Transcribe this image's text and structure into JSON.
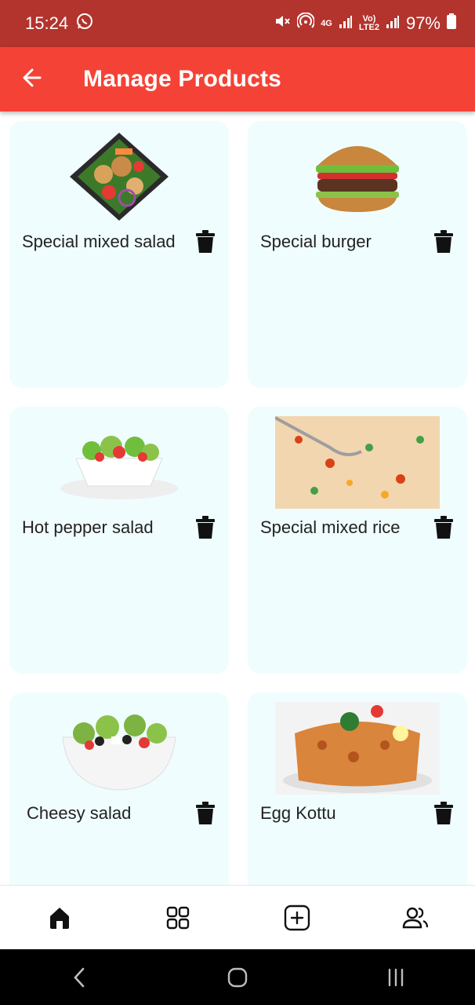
{
  "status_bar": {
    "time": "15:24",
    "lte_label": "LTE2",
    "vo_label": "Vo)",
    "net_label": "4G",
    "battery": "97%"
  },
  "app_bar": {
    "title": "Manage Products"
  },
  "products": [
    {
      "name": "Special mixed salad",
      "image": "salad-plate-icon"
    },
    {
      "name": "Special burger",
      "image": "burger-icon"
    },
    {
      "name": "Hot pepper salad",
      "image": "salad-bowl-icon"
    },
    {
      "name": "Special mixed rice",
      "image": "fried-rice-icon"
    },
    {
      "name": "Cheesy salad",
      "image": "greek-salad-icon"
    },
    {
      "name": "Egg Kottu",
      "image": "kottu-icon"
    }
  ],
  "bottom_nav": [
    {
      "icon": "home-icon",
      "active": true
    },
    {
      "icon": "grid-icon",
      "active": false
    },
    {
      "icon": "add-square-icon",
      "active": false
    },
    {
      "icon": "users-icon",
      "active": false
    }
  ],
  "colors": {
    "status_bar": "#b3332d",
    "app_bar": "#f44336",
    "card_bg": "#f0fdfe"
  }
}
